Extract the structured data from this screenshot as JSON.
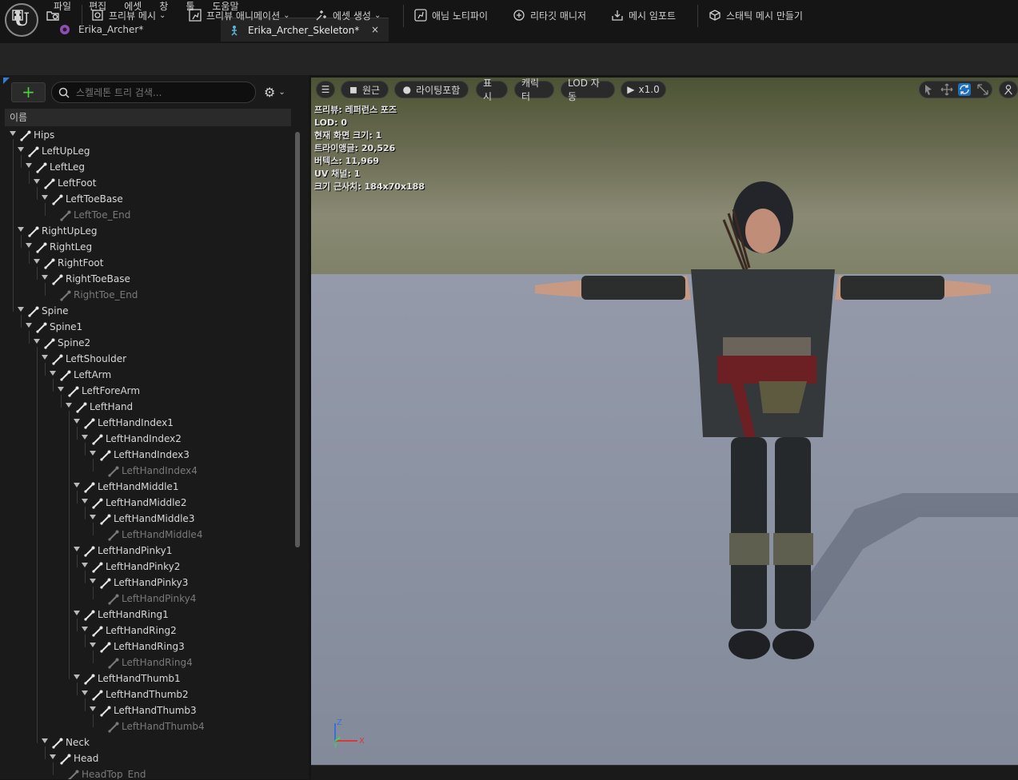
{
  "menu": [
    "파일",
    "편집",
    "에셋",
    "창",
    "툴",
    "도움말"
  ],
  "tabs": [
    {
      "label": "Erika_Archer*"
    },
    {
      "label": "Erika_Archer_Skeleton*",
      "close": "×"
    }
  ],
  "toolbar": {
    "preview_mesh": "프리뷰 메시",
    "preview_anim": "프리뷰 애니메이션",
    "create_asset": "에셋 생성",
    "anim_notify": "애님 노티파이",
    "retarget_manager": "리타깃 매니저",
    "import_mesh": "메시 임포트",
    "make_static_mesh": "스태틱 메시 만들기"
  },
  "skeleton_tree": {
    "search_placeholder": "스켈레톤 트리 검색...",
    "add_label": "+",
    "column_header": "이름",
    "bones": [
      {
        "name": "Hips",
        "depth": 0,
        "leaf": false
      },
      {
        "name": "LeftUpLeg",
        "depth": 1,
        "leaf": false
      },
      {
        "name": "LeftLeg",
        "depth": 2,
        "leaf": false
      },
      {
        "name": "LeftFoot",
        "depth": 3,
        "leaf": false
      },
      {
        "name": "LeftToeBase",
        "depth": 4,
        "leaf": false
      },
      {
        "name": "LeftToe_End",
        "depth": 5,
        "leaf": true
      },
      {
        "name": "RightUpLeg",
        "depth": 1,
        "leaf": false
      },
      {
        "name": "RightLeg",
        "depth": 2,
        "leaf": false
      },
      {
        "name": "RightFoot",
        "depth": 3,
        "leaf": false
      },
      {
        "name": "RightToeBase",
        "depth": 4,
        "leaf": false
      },
      {
        "name": "RightToe_End",
        "depth": 5,
        "leaf": true
      },
      {
        "name": "Spine",
        "depth": 1,
        "leaf": false
      },
      {
        "name": "Spine1",
        "depth": 2,
        "leaf": false
      },
      {
        "name": "Spine2",
        "depth": 3,
        "leaf": false
      },
      {
        "name": "LeftShoulder",
        "depth": 4,
        "leaf": false
      },
      {
        "name": "LeftArm",
        "depth": 5,
        "leaf": false
      },
      {
        "name": "LeftForeArm",
        "depth": 6,
        "leaf": false
      },
      {
        "name": "LeftHand",
        "depth": 7,
        "leaf": false
      },
      {
        "name": "LeftHandIndex1",
        "depth": 8,
        "leaf": false
      },
      {
        "name": "LeftHandIndex2",
        "depth": 9,
        "leaf": false
      },
      {
        "name": "LeftHandIndex3",
        "depth": 10,
        "leaf": false
      },
      {
        "name": "LeftHandIndex4",
        "depth": 11,
        "leaf": true
      },
      {
        "name": "LeftHandMiddle1",
        "depth": 8,
        "leaf": false
      },
      {
        "name": "LeftHandMiddle2",
        "depth": 9,
        "leaf": false
      },
      {
        "name": "LeftHandMiddle3",
        "depth": 10,
        "leaf": false
      },
      {
        "name": "LeftHandMiddle4",
        "depth": 11,
        "leaf": true
      },
      {
        "name": "LeftHandPinky1",
        "depth": 8,
        "leaf": false
      },
      {
        "name": "LeftHandPinky2",
        "depth": 9,
        "leaf": false
      },
      {
        "name": "LeftHandPinky3",
        "depth": 10,
        "leaf": false
      },
      {
        "name": "LeftHandPinky4",
        "depth": 11,
        "leaf": true
      },
      {
        "name": "LeftHandRing1",
        "depth": 8,
        "leaf": false
      },
      {
        "name": "LeftHandRing2",
        "depth": 9,
        "leaf": false
      },
      {
        "name": "LeftHandRing3",
        "depth": 10,
        "leaf": false
      },
      {
        "name": "LeftHandRing4",
        "depth": 11,
        "leaf": true
      },
      {
        "name": "LeftHandThumb1",
        "depth": 8,
        "leaf": false
      },
      {
        "name": "LeftHandThumb2",
        "depth": 9,
        "leaf": false
      },
      {
        "name": "LeftHandThumb3",
        "depth": 10,
        "leaf": false
      },
      {
        "name": "LeftHandThumb4",
        "depth": 11,
        "leaf": true
      },
      {
        "name": "Neck",
        "depth": 4,
        "leaf": false
      },
      {
        "name": "Head",
        "depth": 5,
        "leaf": false
      },
      {
        "name": "HeadTop_End",
        "depth": 6,
        "leaf": true
      }
    ]
  },
  "viewport": {
    "perspective": "원근",
    "lighting": "라이팅포함",
    "show": "표시",
    "character": "캐릭터",
    "lod": "LOD 자동",
    "speed": "x1.0",
    "stats": [
      "프리뷰: 레퍼런스 포즈",
      "LOD: 0",
      "현재 화면 크기: 1",
      "트라이앵글: 20,526",
      "버텍스: 11,969",
      "UV 채널: 1",
      "크기 근사치: 184x70x188"
    ],
    "axis": {
      "z": "Z",
      "x": "X",
      "y": "Y"
    }
  },
  "colors": {
    "accent_blue": "#2f7fd4",
    "add_green": "#4fcf40",
    "active_tool": "#1f6fb8"
  }
}
